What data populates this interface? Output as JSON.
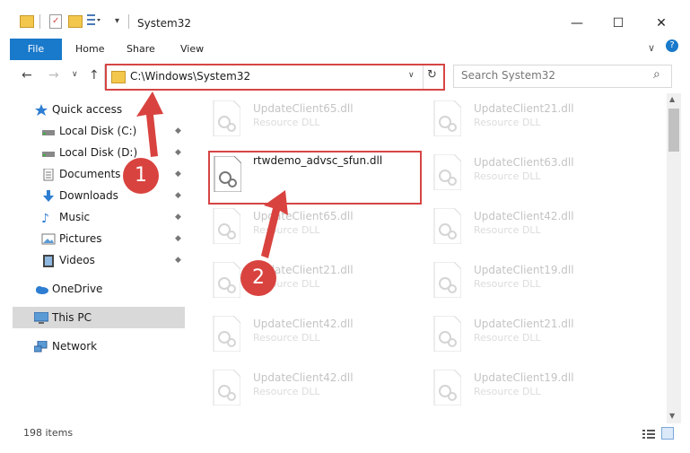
{
  "window": {
    "title": "System32",
    "minimize_glyph": "—",
    "maximize_glyph": "☐",
    "close_glyph": "✕"
  },
  "ribbon": {
    "tabs": [
      "File",
      "Home",
      "Share",
      "View"
    ],
    "collapse_glyph": "∨",
    "help_glyph": "?"
  },
  "nav": {
    "back_glyph": "←",
    "forward_glyph": "→",
    "recent_glyph": "∨",
    "up_glyph": "↑",
    "address": "C:\\Windows\\System32",
    "address_dropdown_glyph": "∨",
    "refresh_glyph": "↻",
    "search_placeholder": "Search System32",
    "search_glyph": "⌕"
  },
  "sidebar": {
    "items": [
      {
        "label": "Quick access",
        "icon": "star-icon",
        "pinned": false
      },
      {
        "label": "Local Disk (C:)",
        "icon": "drive-icon",
        "pinned": true
      },
      {
        "label": "Local Disk (D:)",
        "icon": "drive-icon",
        "pinned": true
      },
      {
        "label": "Documents",
        "icon": "documents-icon",
        "pinned": true
      },
      {
        "label": "Downloads",
        "icon": "download-icon",
        "pinned": true
      },
      {
        "label": "Music",
        "icon": "music-icon",
        "pinned": true
      },
      {
        "label": "Pictures",
        "icon": "pictures-icon",
        "pinned": true
      },
      {
        "label": "Videos",
        "icon": "videos-icon",
        "pinned": true
      },
      {
        "label": "OneDrive",
        "icon": "cloud-icon",
        "pinned": false
      },
      {
        "label": "This PC",
        "icon": "computer-icon",
        "pinned": false,
        "selected": true
      },
      {
        "label": "Network",
        "icon": "network-icon",
        "pinned": false
      }
    ],
    "pin_glyph": "📌"
  },
  "files": {
    "left_column": [
      {
        "name": "UpdateClient65.dll",
        "type": "Resource DLL"
      },
      {
        "name": "UpdateClient65.dll",
        "type": "Resource DLL"
      },
      {
        "name": "UpdateClient21.dll",
        "type": "Resource DLL"
      },
      {
        "name": "UpdateClient42.dll",
        "type": "Resource DLL"
      },
      {
        "name": "UpdateClient42.dll",
        "type": "Resource DLL"
      }
    ],
    "right_column": [
      {
        "name": "UpdateClient21.dll",
        "type": "Resource DLL"
      },
      {
        "name": "UpdateClient63.dll",
        "type": "Resource DLL"
      },
      {
        "name": "UpdateClient42.dll",
        "type": "Resource DLL"
      },
      {
        "name": "UpdateClient19.dll",
        "type": "Resource DLL"
      },
      {
        "name": "UpdateClient21.dll",
        "type": "Resource DLL"
      },
      {
        "name": "UpdateClient19.dll",
        "type": "Resource DLL"
      }
    ],
    "selected": {
      "name": "rtwdemo_advsc_sfun.dll"
    }
  },
  "status": {
    "item_count": "198 items"
  },
  "markers": {
    "step1": "1",
    "step2": "2"
  },
  "colors": {
    "accent": "#1979ca",
    "highlight_red": "#d64545",
    "marker_red": "#d9433f"
  }
}
